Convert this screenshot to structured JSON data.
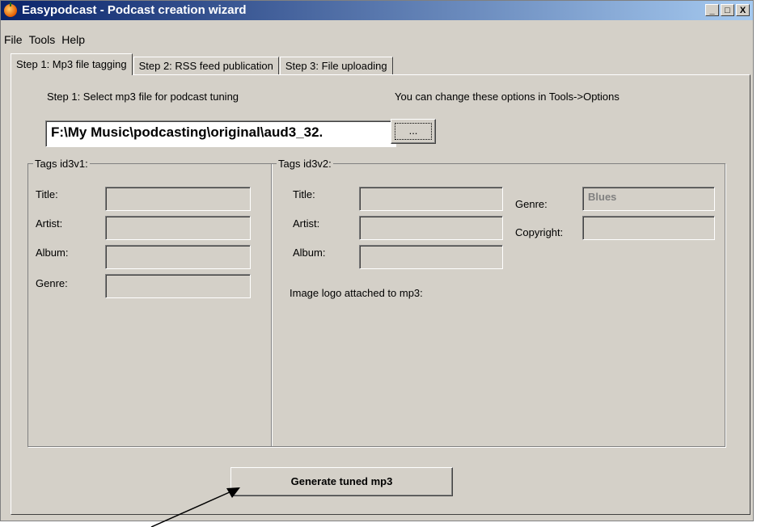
{
  "window": {
    "title": "Easypodcast - Podcast creation wizard",
    "controls": {
      "minimize": "_",
      "maximize": "□",
      "close": "X"
    }
  },
  "menu": [
    "File",
    "Tools",
    "Help"
  ],
  "tabs": [
    "Step 1: Mp3 file tagging",
    "Step 2: RSS feed publication",
    "Step 3: File uploading"
  ],
  "step1": {
    "instruction": "Step 1: Select mp3 file for podcast tuning",
    "options_hint": "You can change these options in Tools->Options",
    "file_path": "F:\\My Music\\podcasting\\original\\aud3_32.",
    "browse_label": "..."
  },
  "id3v1": {
    "legend": "Tags id3v1:",
    "fields": [
      {
        "label": "Title:",
        "value": ""
      },
      {
        "label": "Artist:",
        "value": ""
      },
      {
        "label": "Album:",
        "value": ""
      },
      {
        "label": "Genre:",
        "value": ""
      }
    ]
  },
  "id3v2": {
    "legend": "Tags id3v2:",
    "fields": [
      {
        "label": "Title:",
        "value": ""
      },
      {
        "label": "Artist:",
        "value": ""
      },
      {
        "label": "Album:",
        "value": ""
      }
    ],
    "genre_label": "Genre:",
    "genre_value": "Blues",
    "copyright_label": "Copyright:",
    "copyright_value": "",
    "image_logo_label": "Image logo attached to mp3:"
  },
  "generate_label": "Generate tuned mp3"
}
